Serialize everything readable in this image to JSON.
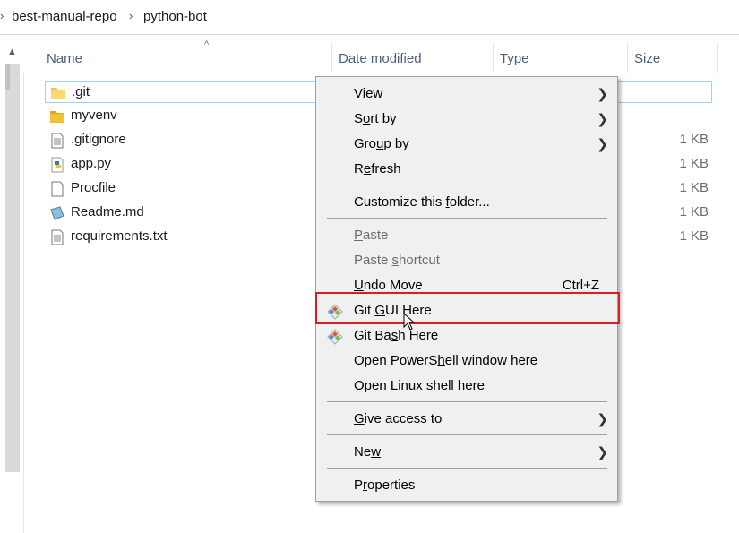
{
  "breadcrumb": {
    "items": [
      "best-manual-repo",
      "python-bot"
    ]
  },
  "columns": {
    "name": "Name",
    "date_modified": "Date modified",
    "type": "Type",
    "size": "Size"
  },
  "files": [
    {
      "name": ".git",
      "size": "",
      "icon": "folder-icon"
    },
    {
      "name": "myvenv",
      "size": "",
      "icon": "folder-icon"
    },
    {
      "name": ".gitignore",
      "size": "1 KB",
      "icon": "text-file-icon"
    },
    {
      "name": "app.py",
      "size": "1 KB",
      "icon": "python-file-icon"
    },
    {
      "name": "Procfile",
      "size": "1 KB",
      "icon": "blank-file-icon"
    },
    {
      "name": "Readme.md",
      "size": "1 KB",
      "icon": "markdown-file-icon"
    },
    {
      "name": "requirements.txt",
      "size": "1 KB",
      "icon": "text-file-icon"
    }
  ],
  "context_menu": {
    "view": {
      "pre": "",
      "key": "V",
      "post": "iew"
    },
    "sort_by": {
      "pre": "S",
      "key": "o",
      "post": "rt by"
    },
    "group_by": {
      "pre": "Gro",
      "key": "u",
      "post": "p by"
    },
    "refresh": {
      "pre": "R",
      "key": "e",
      "post": "fresh"
    },
    "customize": {
      "pre": "Customize this ",
      "key": "f",
      "post": "older..."
    },
    "paste": {
      "pre": "",
      "key": "P",
      "post": "aste"
    },
    "paste_shortcut": {
      "pre": "Paste ",
      "key": "s",
      "post": "hortcut"
    },
    "undo_move": {
      "pre": "",
      "key": "U",
      "post": "ndo Move"
    },
    "undo_shortcut": "Ctrl+Z",
    "git_gui": {
      "pre": "Git ",
      "key": "G",
      "post": "UI Here"
    },
    "git_bash": {
      "pre": "Git Ba",
      "key": "s",
      "post": "h Here"
    },
    "powershell": {
      "pre": "Open PowerS",
      "key": "h",
      "post": "ell window here"
    },
    "linux_shell": {
      "pre": "Open ",
      "key": "L",
      "post": "inux shell here"
    },
    "give_access": {
      "pre": "",
      "key": "G",
      "post": "ive access to"
    },
    "new": {
      "pre": "Ne",
      "key": "w",
      "post": ""
    },
    "properties": {
      "pre": "P",
      "key": "r",
      "post": "operties"
    }
  },
  "colors": {
    "highlight_border": "#d32027",
    "menu_bg": "#f0f0f0",
    "selection_border": "#99d1ff"
  }
}
